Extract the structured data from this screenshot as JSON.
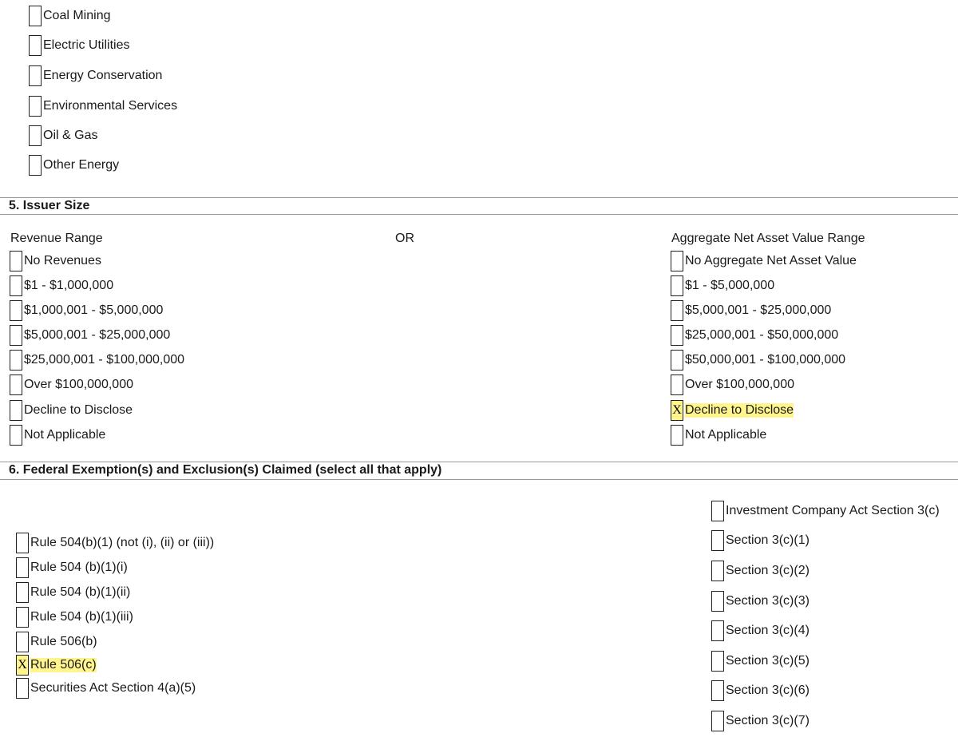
{
  "industry": {
    "items": [
      {
        "label": "Coal Mining",
        "checked": false
      },
      {
        "label": "Electric Utilities",
        "checked": false
      },
      {
        "label": "Energy Conservation",
        "checked": false
      },
      {
        "label": "Environmental Services",
        "checked": false
      },
      {
        "label": "Oil & Gas",
        "checked": false
      },
      {
        "label": "Other Energy",
        "checked": false
      }
    ]
  },
  "issuer_size": {
    "title": "5. Issuer Size",
    "revenue_header": "Revenue Range",
    "or_label": "OR",
    "nav_header": "Aggregate Net Asset Value Range",
    "revenue": [
      {
        "label": "No Revenues",
        "checked": false
      },
      {
        "label": "$1 - $1,000,000",
        "checked": false
      },
      {
        "label": "$1,000,001 - $5,000,000",
        "checked": false
      },
      {
        "label": "$5,000,001 - $25,000,000",
        "checked": false
      },
      {
        "label": "$25,000,001 - $100,000,000",
        "checked": false
      },
      {
        "label": "Over $100,000,000",
        "checked": false
      },
      {
        "label": "Decline to Disclose",
        "checked": false
      },
      {
        "label": "Not Applicable",
        "checked": false
      }
    ],
    "nav": [
      {
        "label": "No Aggregate Net Asset Value",
        "checked": false
      },
      {
        "label": "$1 - $5,000,000",
        "checked": false
      },
      {
        "label": "$5,000,001 - $25,000,000",
        "checked": false
      },
      {
        "label": "$25,000,001 - $50,000,000",
        "checked": false
      },
      {
        "label": "$50,000,001 - $100,000,000",
        "checked": false
      },
      {
        "label": "Over $100,000,000",
        "checked": false
      },
      {
        "label": "Decline to Disclose",
        "checked": true
      },
      {
        "label": "Not Applicable",
        "checked": false
      }
    ]
  },
  "exemptions": {
    "title": "6. Federal Exemption(s) and Exclusion(s) Claimed (select all that apply)",
    "left": [
      {
        "label": "Rule 504(b)(1) (not (i), (ii) or (iii))",
        "checked": false
      },
      {
        "label": "Rule 504 (b)(1)(i)",
        "checked": false
      },
      {
        "label": "Rule 504 (b)(1)(ii)",
        "checked": false
      },
      {
        "label": "Rule 504 (b)(1)(iii)",
        "checked": false
      },
      {
        "label": "Rule 506(b)",
        "checked": false
      },
      {
        "label": "Rule 506(c)",
        "checked": true
      },
      {
        "label": "Securities Act Section 4(a)(5)",
        "checked": false
      }
    ],
    "right": [
      {
        "label": "Investment Company Act Section 3(c)",
        "checked": false
      },
      {
        "label": "Section 3(c)(1)",
        "checked": false
      },
      {
        "label": "Section 3(c)(2)",
        "checked": false
      },
      {
        "label": "Section 3(c)(3)",
        "checked": false
      },
      {
        "label": "Section 3(c)(4)",
        "checked": false
      },
      {
        "label": "Section 3(c)(5)",
        "checked": false
      },
      {
        "label": "Section 3(c)(6)",
        "checked": false
      },
      {
        "label": "Section 3(c)(7)",
        "checked": false
      }
    ]
  },
  "check_mark": "X",
  "colors": {
    "highlight": "#fff58c"
  }
}
